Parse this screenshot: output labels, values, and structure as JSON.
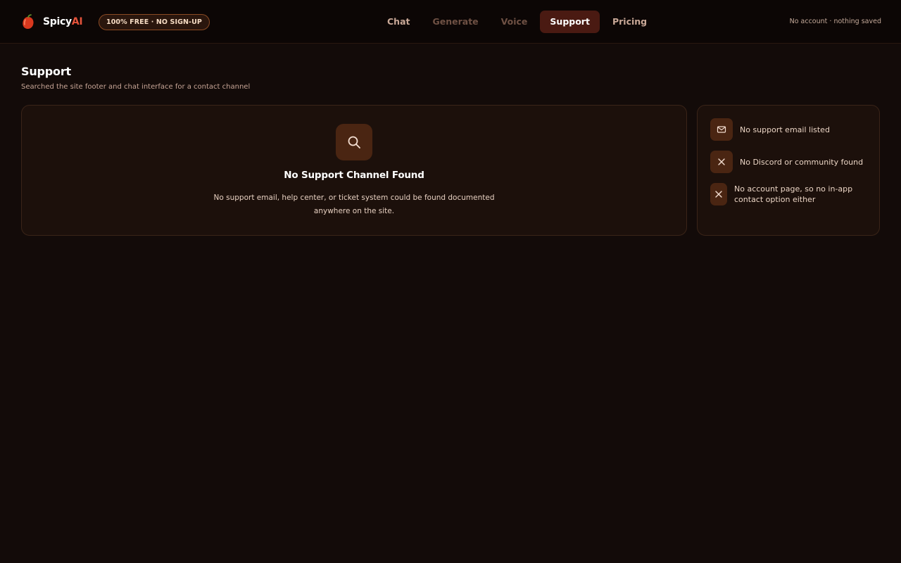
{
  "header": {
    "brand_name": "Spicy",
    "brand_suffix": "AI",
    "badge": "100% FREE · NO SIGN-UP",
    "account_status": "No account · nothing saved",
    "brand_color": "#e5533b"
  },
  "nav": {
    "items": [
      {
        "label": "Chat",
        "state": "normal"
      },
      {
        "label": "Generate",
        "state": "dim"
      },
      {
        "label": "Voice",
        "state": "dim"
      },
      {
        "label": "Support",
        "state": "active"
      },
      {
        "label": "Pricing",
        "state": "normal"
      }
    ]
  },
  "page": {
    "title": "Support",
    "subtitle": "Searched the site footer and chat interface for a contact channel"
  },
  "main_card": {
    "icon": "search-icon",
    "heading": "No Support Channel Found",
    "text": "No support email, help center, or ticket system could be found documented anywhere on the site."
  },
  "checklist": {
    "items": [
      {
        "icon": "mail-icon",
        "label": "No support email listed"
      },
      {
        "icon": "close-icon",
        "label": "No Discord or community found"
      },
      {
        "icon": "close-icon",
        "label": "No account page, so no in-app contact option either"
      }
    ]
  }
}
